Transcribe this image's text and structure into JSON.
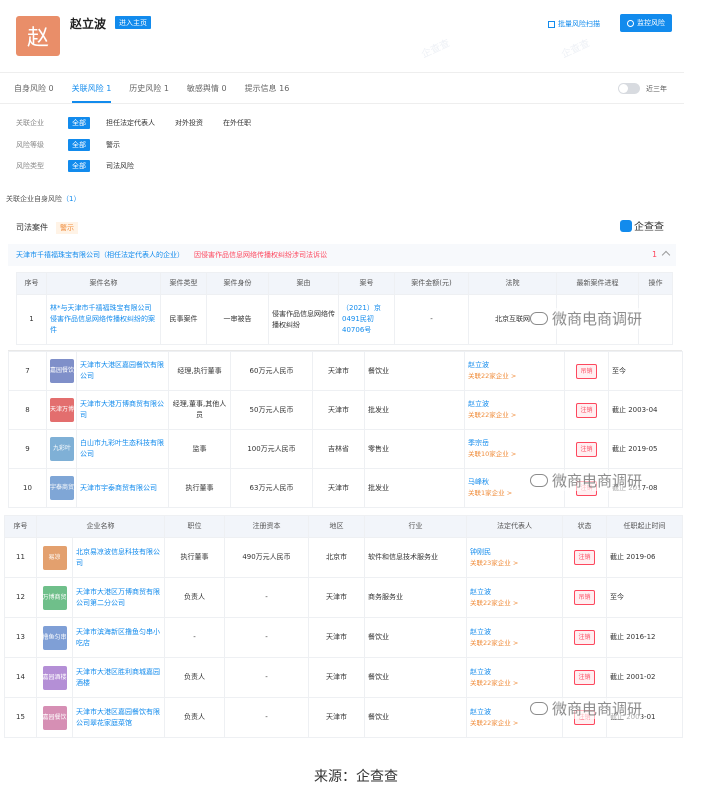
{
  "header": {
    "avatar_char": "赵",
    "name": "赵立波",
    "home_btn": "进入主页",
    "batch_label": "批量风险扫描",
    "monitor_label": "监控风险"
  },
  "tabs": [
    {
      "label": "自身风险",
      "count": "0"
    },
    {
      "label": "关联风险",
      "count": "1"
    },
    {
      "label": "历史风险",
      "count": "1"
    },
    {
      "label": "敏感舆情",
      "count": "0"
    },
    {
      "label": "提示信息",
      "count": "16"
    }
  ],
  "toggle_label": "近三年",
  "filters": [
    {
      "label": "关联企业",
      "options": [
        "全部",
        "担任法定代表人",
        "对外投资",
        "在外任职"
      ]
    },
    {
      "label": "风险等级",
      "options": [
        "全部",
        "警示"
      ]
    },
    {
      "label": "风险类型",
      "options": [
        "全部",
        "司法风险"
      ]
    }
  ],
  "related_title": "关联企业自身风险",
  "related_count": "（1）",
  "judicial": {
    "title": "司法案件",
    "badge": "警示",
    "brand": "企查查",
    "company_line": "天津市千禧福珠宝有限公司（相任法定代表人的企业）",
    "cause_line": "因侵害作品信息网络传播权纠纷涉司法诉讼",
    "count": "1",
    "headers": [
      "序号",
      "案件名称",
      "案件类型",
      "案件身份",
      "案由",
      "案号",
      "案件金额(元)",
      "法院",
      "最新案件进程",
      "操作"
    ],
    "row": {
      "no": "1",
      "name": "林*与天津市千禧福珠宝有限公司侵害作品信息网络传播权纠纷的案件",
      "type": "民事案件",
      "role": "一审被告",
      "cause": "侵害作品信息网络传播权纠纷",
      "case_no": "（2021）京0491民初40706号",
      "amount": "-",
      "court": "北京互联网"
    }
  },
  "t1": {
    "rows": [
      {
        "no": "7",
        "logo": "嘉园餐饮",
        "logo_color": "#7f8fc9",
        "name": "天津市大港区嘉园餐饮有限公司",
        "position": "经理,执行董事",
        "capital": "60万元人民币",
        "region": "天津市",
        "industry": "餐饮业",
        "rep": "赵立波",
        "rep_sub": "关联22家企业 >",
        "status": "吊销",
        "term": "至今"
      },
      {
        "no": "8",
        "logo": "天津万博",
        "logo_color": "#e36e6e",
        "name": "天津市大港万博商贸有限公司",
        "position": "经理,董事,其他人员",
        "capital": "50万元人民币",
        "region": "天津市",
        "industry": "批发业",
        "rep": "赵立波",
        "rep_sub": "关联22家企业 >",
        "status": "注销",
        "term": "截止 2003-04"
      },
      {
        "no": "9",
        "logo": "九彩叶",
        "logo_color": "#7fb0d6",
        "name": "白山市九彩叶生态科技有限公司",
        "position": "监事",
        "capital": "100万元人民币",
        "region": "吉林省",
        "industry": "零售业",
        "rep": "季宗岳",
        "rep_sub": "关联10家企业 >",
        "status": "注销",
        "term": "截止 2019-05"
      },
      {
        "no": "10",
        "logo": "宇泰商贸",
        "logo_color": "#7fa6d6",
        "name": "天津市宇泰商贸有限公司",
        "position": "执行董事",
        "capital": "63万元人民币",
        "region": "天津市",
        "industry": "批发业",
        "rep": "马峰秋",
        "rep_sub": "关联1家企业 >",
        "status": "注销",
        "term": "截止 2017-08"
      }
    ]
  },
  "t2": {
    "headers": [
      "序号",
      "企业名称",
      "职位",
      "注册资本",
      "地区",
      "行业",
      "法定代表人",
      "状态",
      "任职起止时间"
    ],
    "rows": [
      {
        "no": "11",
        "logo": "易凉",
        "logo_color": "#e3a06e",
        "name": "北京易凉波信息科技有限公司",
        "position": "执行董事",
        "capital": "490万元人民币",
        "region": "北京市",
        "industry": "软件和信息技术服务业",
        "rep": "钟刚民",
        "rep_sub": "关联23家企业 >",
        "status": "注销",
        "term": "截止 2019-06"
      },
      {
        "no": "12",
        "logo": "万博商贸",
        "logo_color": "#6fbf8a",
        "name": "天津市大港区万博商贸有限公司第二分公司",
        "position": "负责人",
        "capital": "-",
        "region": "天津市",
        "industry": "商务服务业",
        "rep": "赵立波",
        "rep_sub": "关联22家企业 >",
        "status": "吊销",
        "term": "至今"
      },
      {
        "no": "13",
        "logo": "撸鱼匀串",
        "logo_color": "#7f9fd6",
        "name": "天津市滨海新区撸鱼匀串小吃店",
        "position": "-",
        "capital": "-",
        "region": "天津市",
        "industry": "餐饮业",
        "rep": "赵立波",
        "rep_sub": "关联22家企业 >",
        "status": "注销",
        "term": "截止 2016-12"
      },
      {
        "no": "14",
        "logo": "嘉园酒楼",
        "logo_color": "#b48fd6",
        "name": "天津市大港区胜利商城嘉园酒楼",
        "position": "负责人",
        "capital": "-",
        "region": "天津市",
        "industry": "餐饮业",
        "rep": "赵立波",
        "rep_sub": "关联22家企业 >",
        "status": "注销",
        "term": "截止 2001-02"
      },
      {
        "no": "15",
        "logo": "嘉园餐饮",
        "logo_color": "#d68fb4",
        "name": "天津市大港区嘉园餐饮有限公司翠花家庭菜馆",
        "position": "负责人",
        "capital": "-",
        "region": "天津市",
        "industry": "餐饮业",
        "rep": "赵立波",
        "rep_sub": "关联22家企业 >",
        "status": "注销",
        "term": "截止 2003-01"
      }
    ]
  },
  "watermark": "微商电商调研",
  "source_caption": "来源：企查查",
  "colors": {
    "accent": "#128bed",
    "danger": "#fd485e",
    "avatar": "#e98e69"
  }
}
